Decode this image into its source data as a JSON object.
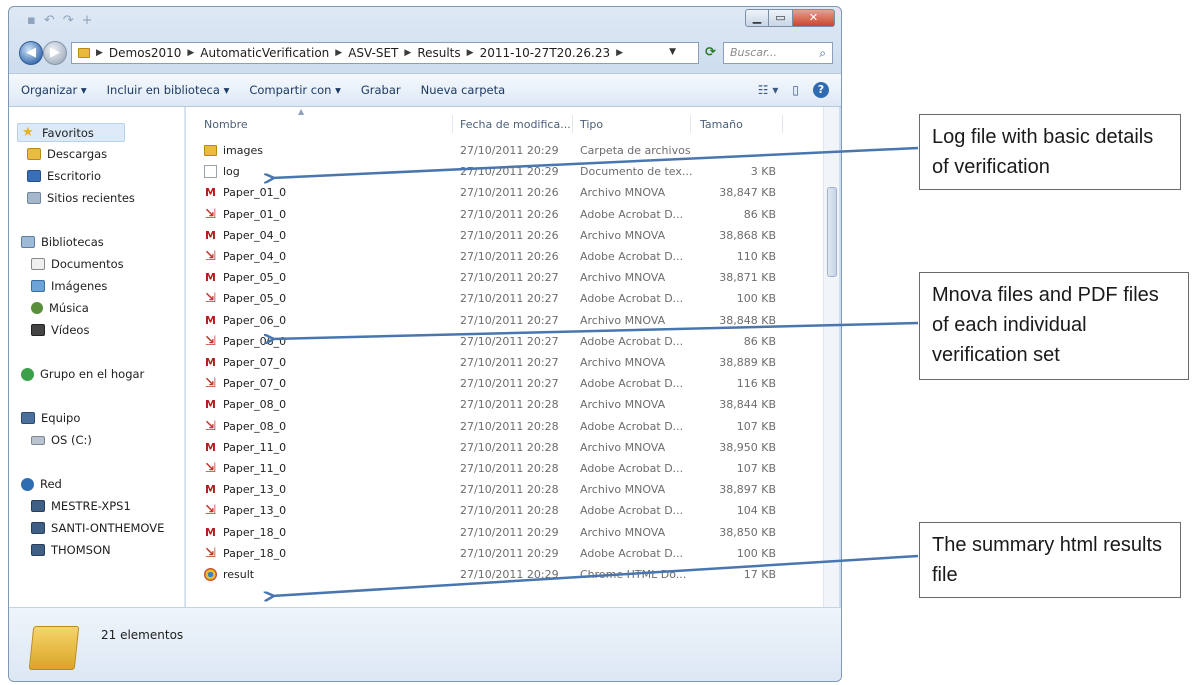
{
  "window": {
    "address": {
      "crumbs": [
        "Demos2010",
        "AutomaticVerification",
        "ASV-SET",
        "Results",
        "2011-10-27T20.26.23"
      ],
      "search_placeholder": "Buscar..."
    },
    "toolbar": {
      "organize": "Organizar ▾",
      "include_library": "Incluir en biblioteca ▾",
      "share": "Compartir con ▾",
      "burn": "Grabar",
      "new_folder": "Nueva carpeta"
    },
    "nav": {
      "favorites": "Favoritos",
      "downloads": "Descargas",
      "desktop": "Escritorio",
      "recent": "Sitios recientes",
      "libraries": "Bibliotecas",
      "documents": "Documentos",
      "images": "Imágenes",
      "music": "Música",
      "videos": "Vídeos",
      "homegroup": "Grupo en el hogar",
      "computer": "Equipo",
      "drive": "OS (C:)",
      "network": "Red",
      "net_pc1": "MESTRE-XPS1",
      "net_pc2": "SANTI-ONTHEMOVE",
      "net_pc3": "THOMSON"
    },
    "columns": {
      "name": "Nombre",
      "date": "Fecha de modifica...",
      "type": "Tipo",
      "size": "Tamaño"
    },
    "files": [
      {
        "name": "images",
        "date": "27/10/2011 20:29",
        "type": "Carpeta de archivos",
        "size": "",
        "icon": "folder"
      },
      {
        "name": "log",
        "date": "27/10/2011 20:29",
        "type": "Documento de tex...",
        "size": "3 KB",
        "icon": "text"
      },
      {
        "name": "Paper_01_0",
        "date": "27/10/2011 20:26",
        "type": "Archivo MNOVA",
        "size": "38,847 KB",
        "icon": "mnova"
      },
      {
        "name": "Paper_01_0",
        "date": "27/10/2011 20:26",
        "type": "Adobe Acrobat D...",
        "size": "86 KB",
        "icon": "pdf"
      },
      {
        "name": "Paper_04_0",
        "date": "27/10/2011 20:26",
        "type": "Archivo MNOVA",
        "size": "38,868 KB",
        "icon": "mnova"
      },
      {
        "name": "Paper_04_0",
        "date": "27/10/2011 20:26",
        "type": "Adobe Acrobat D...",
        "size": "110 KB",
        "icon": "pdf"
      },
      {
        "name": "Paper_05_0",
        "date": "27/10/2011 20:27",
        "type": "Archivo MNOVA",
        "size": "38,871 KB",
        "icon": "mnova"
      },
      {
        "name": "Paper_05_0",
        "date": "27/10/2011 20:27",
        "type": "Adobe Acrobat D...",
        "size": "100 KB",
        "icon": "pdf"
      },
      {
        "name": "Paper_06_0",
        "date": "27/10/2011 20:27",
        "type": "Archivo MNOVA",
        "size": "38,848 KB",
        "icon": "mnova"
      },
      {
        "name": "Paper_06_0",
        "date": "27/10/2011 20:27",
        "type": "Adobe Acrobat D...",
        "size": "86 KB",
        "icon": "pdf"
      },
      {
        "name": "Paper_07_0",
        "date": "27/10/2011 20:27",
        "type": "Archivo MNOVA",
        "size": "38,889 KB",
        "icon": "mnova"
      },
      {
        "name": "Paper_07_0",
        "date": "27/10/2011 20:27",
        "type": "Adobe Acrobat D...",
        "size": "116 KB",
        "icon": "pdf"
      },
      {
        "name": "Paper_08_0",
        "date": "27/10/2011 20:28",
        "type": "Archivo MNOVA",
        "size": "38,844 KB",
        "icon": "mnova"
      },
      {
        "name": "Paper_08_0",
        "date": "27/10/2011 20:28",
        "type": "Adobe Acrobat D...",
        "size": "107 KB",
        "icon": "pdf"
      },
      {
        "name": "Paper_11_0",
        "date": "27/10/2011 20:28",
        "type": "Archivo MNOVA",
        "size": "38,950 KB",
        "icon": "mnova"
      },
      {
        "name": "Paper_11_0",
        "date": "27/10/2011 20:28",
        "type": "Adobe Acrobat D...",
        "size": "107 KB",
        "icon": "pdf"
      },
      {
        "name": "Paper_13_0",
        "date": "27/10/2011 20:28",
        "type": "Archivo MNOVA",
        "size": "38,897 KB",
        "icon": "mnova"
      },
      {
        "name": "Paper_13_0",
        "date": "27/10/2011 20:28",
        "type": "Adobe Acrobat D...",
        "size": "104 KB",
        "icon": "pdf"
      },
      {
        "name": "Paper_18_0",
        "date": "27/10/2011 20:29",
        "type": "Archivo MNOVA",
        "size": "38,850 KB",
        "icon": "mnova"
      },
      {
        "name": "Paper_18_0",
        "date": "27/10/2011 20:29",
        "type": "Adobe Acrobat D...",
        "size": "100 KB",
        "icon": "pdf"
      },
      {
        "name": "result",
        "date": "27/10/2011 20:29",
        "type": "Chrome HTML Do...",
        "size": "17 KB",
        "icon": "chrome"
      }
    ],
    "status": "21 elementos"
  },
  "callouts": {
    "log": "Log file with basic details of verification",
    "mnova": "Mnova files and PDF files of each individual verification set",
    "summary": "The summary html results file"
  },
  "colors": {
    "arrow": "#4a76b0",
    "selection": "#dceaf8"
  }
}
